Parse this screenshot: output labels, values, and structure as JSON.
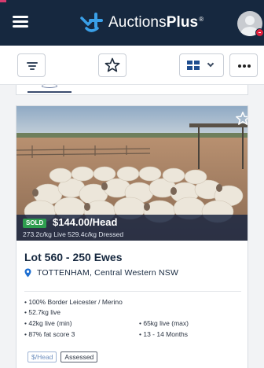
{
  "navbar": {
    "brand_prefix": "Auctions",
    "brand_bold": "Plus",
    "brand_tm": "®"
  },
  "toolbar": {
    "buttons": [
      "filter",
      "favourites",
      "view-toggle",
      "more-options"
    ]
  },
  "listing": {
    "sold_badge": "SOLD",
    "price": "$144.00/Head",
    "price_sub": "273.2c/kg Live 529.4c/kg Dressed",
    "lot_title": "Lot 560 - 250 Ewes",
    "location": "TOTTENHAM, Central Western NSW",
    "specs": [
      "• 100% Border Leicester / Merino",
      "• 52.7kg live",
      "• 42kg live (min)",
      "• 65kg live (max)",
      "• 87% fat score 3",
      "• 13 - 14 Months"
    ],
    "tags": [
      "$/Head",
      "Assessed"
    ]
  },
  "colors": {
    "navbar_bg": "#16283f",
    "brand_accent": "#3aa0e8",
    "sold_badge": "#2e9e4f",
    "price_band": "#1c2842",
    "notification_badge": "#e0223d"
  },
  "icons": {
    "menu": "hamburger-icon",
    "logo": "auctionsplus-logo-icon",
    "filter": "filter-icon",
    "favourite": "star-outline-icon",
    "view": "grid-view-icon",
    "more": "ellipsis-icon",
    "location": "map-pin-icon"
  }
}
